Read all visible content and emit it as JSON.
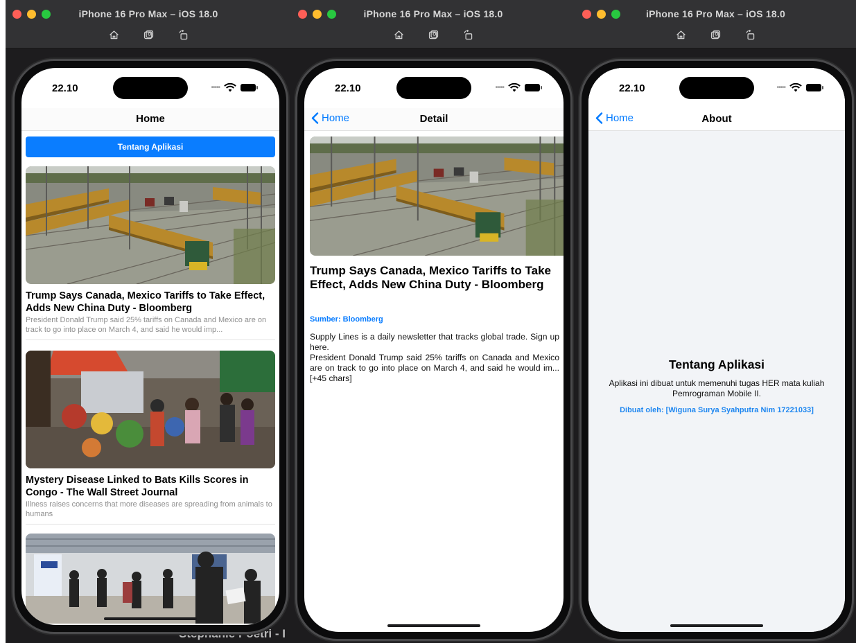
{
  "simulator": {
    "title": "iPhone 16 Pro Max – iOS 18.0",
    "tools": [
      "home-icon",
      "screenshot-icon",
      "rotate-icon"
    ]
  },
  "status": {
    "time": "22.10"
  },
  "screens": {
    "home": {
      "nav_title": "Home",
      "about_button": "Tentang Aplikasi",
      "articles": [
        {
          "title": "Trump Says Canada, Mexico Tariffs to Take Effect, Adds New China Duty - Bloomberg",
          "description": "President Donald Trump said 25% tariffs on Canada and Mexico are on track to go into place on March 4, and said he would imp..."
        },
        {
          "title": "Mystery Disease Linked to Bats Kills Scores in Congo - The Wall Street Journal",
          "description": "Illness raises concerns that more diseases are spreading from animals to humans"
        },
        {
          "title": "",
          "description": ""
        }
      ],
      "background_caption": "Stephanie Poetri - I"
    },
    "detail": {
      "back_label": "Home",
      "nav_title": "Detail",
      "title": "Trump Says Canada, Mexico Tariffs to Take Effect, Adds New China Duty - Bloomberg",
      "source": "Sumber: Bloomberg",
      "body_line1": "Supply Lines is a daily newsletter that tracks global trade. Sign up here.",
      "body_line2": "President Donald Trump said 25% tariffs on Canada and Mexico are on track to go into place on March 4, and said he would im... [+45 chars]"
    },
    "about": {
      "back_label": "Home",
      "nav_title": "About",
      "heading": "Tentang Aplikasi",
      "text": "Aplikasi ini dibuat untuk memenuhi tugas HER mata kuliah Pemrograman Mobile II.",
      "author": "Dibuat oleh: [Wiguna Surya Syahputra Nim 17221033]"
    }
  },
  "colors": {
    "accent": "#0a7dff",
    "titlebar": "#323234",
    "traffic_red": "#fe5f57",
    "traffic_yellow": "#febc2e",
    "traffic_green": "#28c840"
  }
}
